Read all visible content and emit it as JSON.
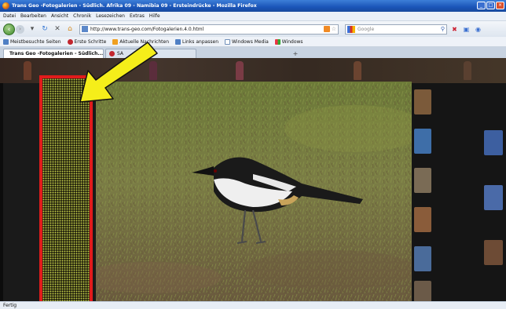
{
  "window": {
    "title": "Trans Geo -Fotogalerien - Südlich. Afrika 09 - Namibia 09 - Ersteindrücke - Mozilla Firefox",
    "controls": [
      "_",
      "□",
      "×"
    ]
  },
  "menu": [
    "Datei",
    "Bearbeiten",
    "Ansicht",
    "Chronik",
    "Lesezeichen",
    "Extras",
    "Hilfe"
  ],
  "navbar": {
    "back_glyph": "‹",
    "forward_glyph": "›",
    "url": "http://www.trans-geo.com/Fotogalerien.4.0.html",
    "search_placeholder": "Google"
  },
  "bookmarks": [
    {
      "label": "Meistbesuchte Seiten",
      "color": "#4f7fc4"
    },
    {
      "label": "Erste Schritte",
      "color": "#c2262e"
    },
    {
      "label": "Aktuelle Nachrichten",
      "color": "#f0a020"
    },
    {
      "label": "Links anpassen",
      "color": "#4f7fc4"
    },
    {
      "label": "Windows Media",
      "color": "#6f8fb8"
    },
    {
      "label": "Windows",
      "color": "#3f9f3f"
    }
  ],
  "tabs": [
    {
      "label": "Trans Geo -Fotogalerien - Südlich...",
      "active": true
    },
    {
      "label": "SA",
      "active": false
    }
  ],
  "status": {
    "text": "Fertig"
  },
  "annotation": {
    "arrow_color": "#f5ee1a",
    "box_color": "#e11b1b"
  }
}
